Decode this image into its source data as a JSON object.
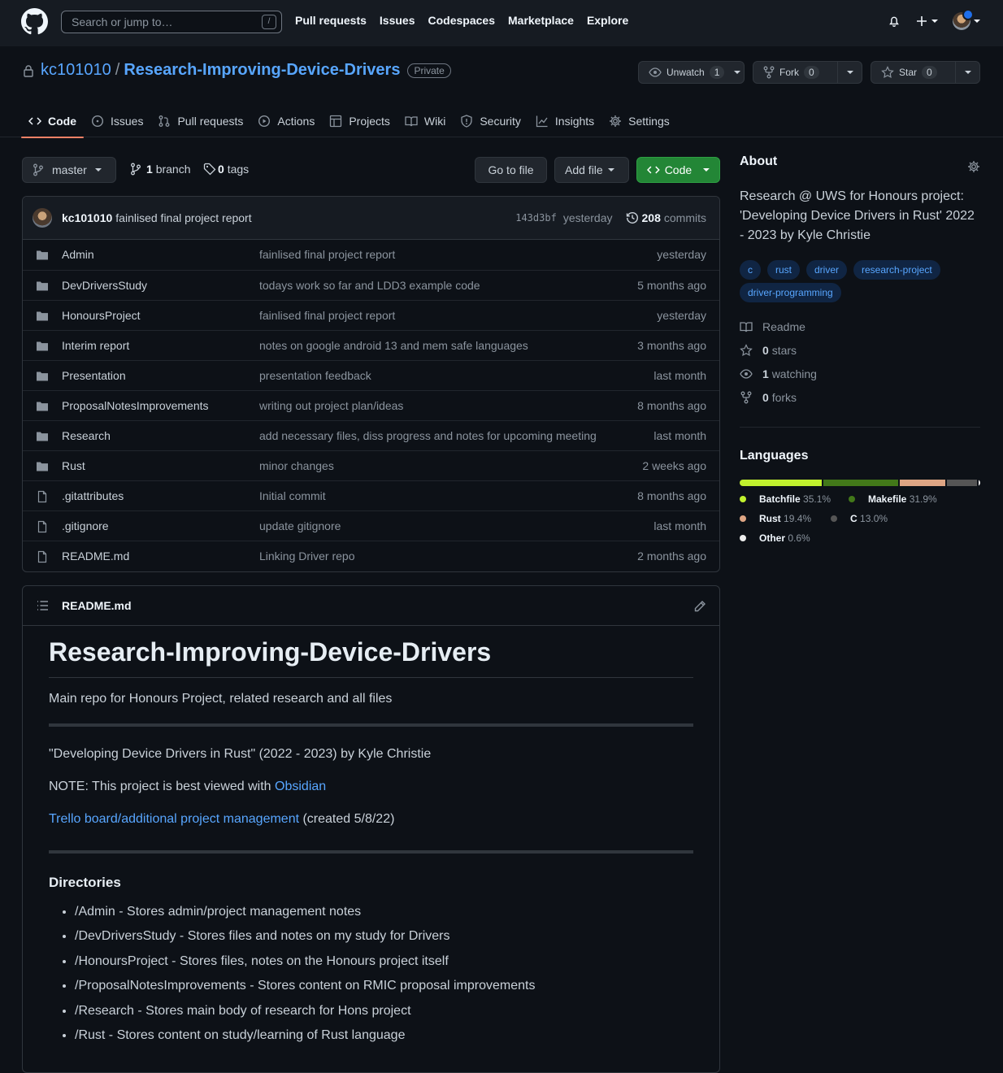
{
  "topbar": {
    "search_placeholder": "Search or jump to…",
    "search_shortcut": "/",
    "nav": [
      "Pull requests",
      "Issues",
      "Codespaces",
      "Marketplace",
      "Explore"
    ]
  },
  "repo": {
    "owner": "kc101010",
    "separator": "/",
    "name": "Research-Improving-Device-Drivers",
    "visibility": "Private",
    "unwatch_label": "Unwatch",
    "watch_count": "1",
    "fork_label": "Fork",
    "fork_count": "0",
    "star_label": "Star",
    "star_count": "0"
  },
  "tabs": [
    "Code",
    "Issues",
    "Pull requests",
    "Actions",
    "Projects",
    "Wiki",
    "Security",
    "Insights",
    "Settings"
  ],
  "toolbar": {
    "branch": "master",
    "branch_count": "1",
    "branch_label": "branch",
    "tag_count": "0",
    "tag_label": "tags",
    "go_to_file": "Go to file",
    "add_file": "Add file",
    "code": "Code"
  },
  "commit": {
    "author": "kc101010",
    "message": "fainlised final project report",
    "sha": "143d3bf",
    "time": "yesterday",
    "count": "208",
    "count_label": "commits"
  },
  "files": [
    {
      "name": "Admin",
      "type": "folder",
      "message": "fainlised final project report",
      "age": "yesterday"
    },
    {
      "name": "DevDriversStudy",
      "type": "folder",
      "message": "todays work so far and LDD3 example code",
      "age": "5 months ago"
    },
    {
      "name": "HonoursProject",
      "type": "folder",
      "message": "fainlised final project report",
      "age": "yesterday"
    },
    {
      "name": "Interim report",
      "type": "folder",
      "message": "notes on google android 13 and mem safe languages",
      "age": "3 months ago"
    },
    {
      "name": "Presentation",
      "type": "folder",
      "message": "presentation feedback",
      "age": "last month"
    },
    {
      "name": "ProposalNotesImprovements",
      "type": "folder",
      "message": "writing out project plan/ideas",
      "age": "8 months ago"
    },
    {
      "name": "Research",
      "type": "folder",
      "message": "add necessary files, diss progress and notes for upcoming meeting",
      "age": "last month"
    },
    {
      "name": "Rust",
      "type": "folder",
      "message": "minor changes",
      "age": "2 weeks ago"
    },
    {
      "name": ".gitattributes",
      "type": "file",
      "message": "Initial commit",
      "age": "8 months ago"
    },
    {
      "name": ".gitignore",
      "type": "file",
      "message": "update gitignore",
      "age": "last month"
    },
    {
      "name": "README.md",
      "type": "file",
      "message": "Linking Driver repo",
      "age": "2 months ago"
    }
  ],
  "readme": {
    "filename": "README.md",
    "h1": "Research-Improving-Device-Drivers",
    "intro": "Main repo for Honours Project, related research and all files",
    "subtitle": "\"Developing Device Drivers in Rust\" (2022 - 2023) by Kyle Christie",
    "note_prefix": "NOTE: This project is best viewed with ",
    "note_link": "Obsidian",
    "trello_link": "Trello board/additional project management",
    "trello_suffix": " (created 5/8/22)",
    "dirs_heading": "Directories",
    "dirs": [
      "/Admin - Stores admin/project management notes",
      "/DevDriversStudy - Stores files and notes on my study for Drivers",
      "/HonoursProject - Stores files, notes on the Honours project itself",
      "/ProposalNotesImprovements - Stores content on RMIC proposal improvements",
      "/Research - Stores main body of research for Hons project",
      "/Rust - Stores content on study/learning of Rust language"
    ]
  },
  "about": {
    "heading": "About",
    "description": "Research @ UWS for Honours project: 'Developing Device Drivers in Rust' 2022 - 2023 by Kyle Christie",
    "topics": [
      "c",
      "rust",
      "driver",
      "research-project",
      "driver-programming"
    ],
    "readme_label": "Readme",
    "stars_count": "0",
    "stars_label": "stars",
    "watching_count": "1",
    "watching_label": "watching",
    "forks_count": "0",
    "forks_label": "forks"
  },
  "languages": {
    "heading": "Languages",
    "items": [
      {
        "name": "Batchfile",
        "percent": "35.1%",
        "value": 35.1,
        "color": "#C1F12E"
      },
      {
        "name": "Makefile",
        "percent": "31.9%",
        "value": 31.9,
        "color": "#427819"
      },
      {
        "name": "Rust",
        "percent": "19.4%",
        "value": 19.4,
        "color": "#DEA584"
      },
      {
        "name": "C",
        "percent": "13.0%",
        "value": 13.0,
        "color": "#555555"
      },
      {
        "name": "Other",
        "percent": "0.6%",
        "value": 0.6,
        "color": "#EDEDED"
      }
    ]
  }
}
